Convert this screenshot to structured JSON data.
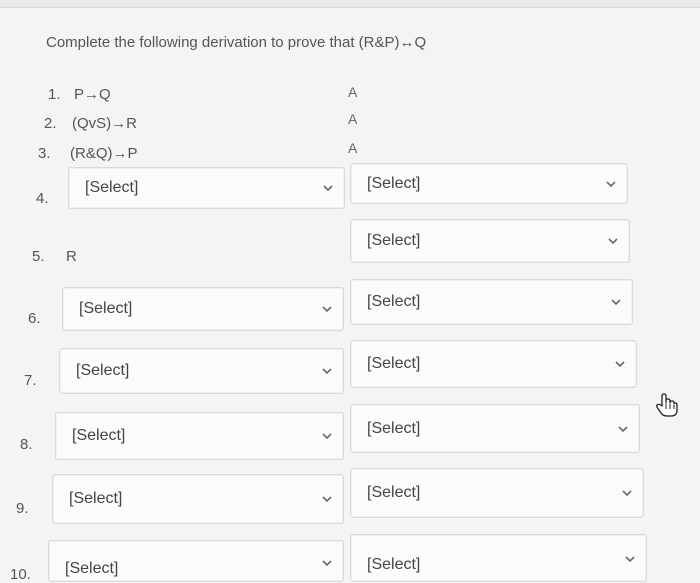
{
  "prompt": "Complete the following derivation to prove that (R&P)↔Q",
  "lines": [
    {
      "num": "1.",
      "formula": "P→Q",
      "justification": "A"
    },
    {
      "num": "2.",
      "formula": "(QvS)→R",
      "justification": "A"
    },
    {
      "num": "3.",
      "formula": "(R&Q)→P",
      "justification": "A"
    },
    {
      "num": "4.",
      "formula_select": "[Select]",
      "justification_select": "[Select]"
    },
    {
      "num": "5.",
      "formula": "R",
      "justification_select": "[Select]"
    },
    {
      "num": "6.",
      "formula_select": "[Select]",
      "justification_select": "[Select]"
    },
    {
      "num": "7.",
      "formula_select": "[Select]",
      "justification_select": "[Select]"
    },
    {
      "num": "8.",
      "formula_select": "[Select]",
      "justification_select": "[Select]"
    },
    {
      "num": "9.",
      "formula_select": "[Select]",
      "justification_select": "[Select]"
    },
    {
      "num": "10.",
      "formula_select": "[Select]",
      "justification_select": "[Select]"
    }
  ],
  "icons": {
    "dropdown": "chevron-down-icon",
    "cursor": "hand-pointer-icon"
  }
}
